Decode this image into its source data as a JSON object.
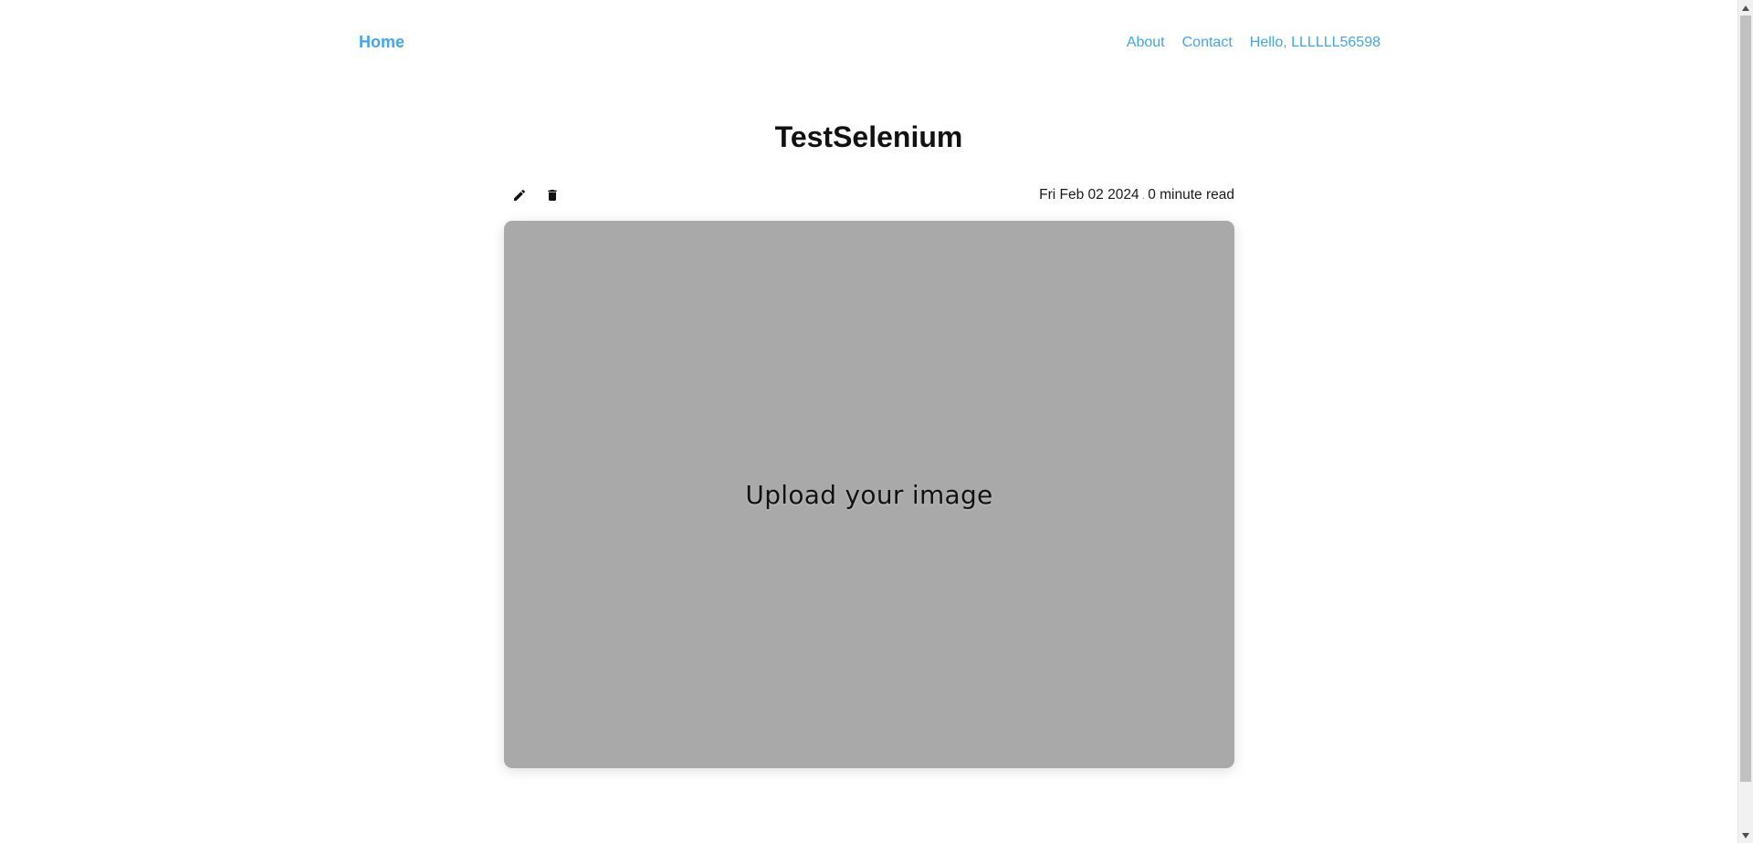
{
  "nav": {
    "home_label": "Home",
    "links": [
      {
        "label": "About"
      },
      {
        "label": "Contact"
      },
      {
        "label": "Hello, LLLLLL56598"
      }
    ]
  },
  "post": {
    "title": "TestSelenium",
    "date": "Fri Feb 02 2024",
    "separator": ".",
    "read_time": "0 minute read",
    "image_placeholder": "Upload your image"
  },
  "icons": {
    "edit": "pencil-icon",
    "delete": "trash-icon"
  },
  "colors": {
    "link": "#42a5f5",
    "placeholder_bg": "#a9a9a9",
    "text": "#111111"
  }
}
